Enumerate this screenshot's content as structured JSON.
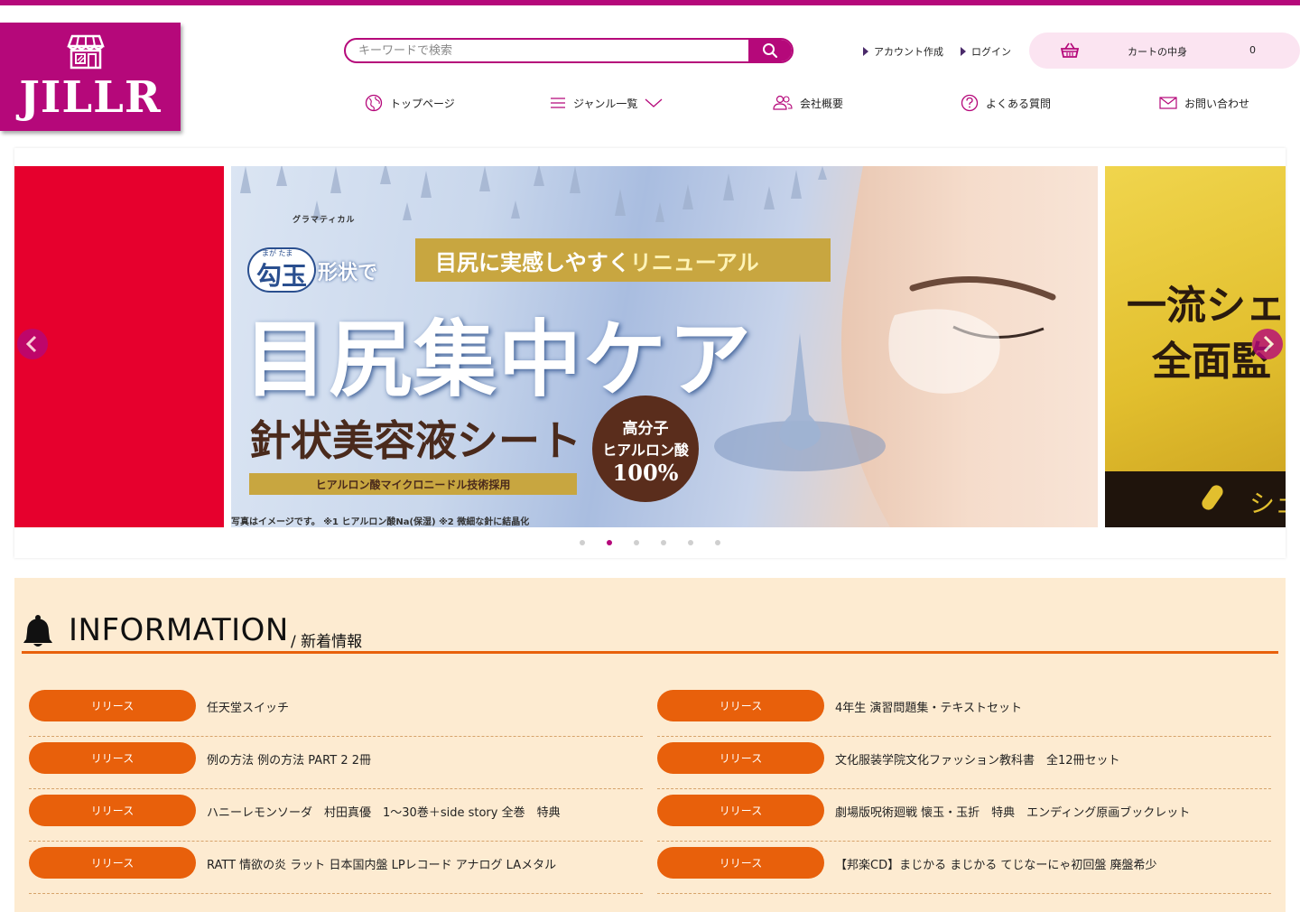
{
  "brand": {
    "logo_text": "JILLR",
    "accent": "#b5087a",
    "orange": "#e8600b"
  },
  "search": {
    "placeholder": "キーワードで検索"
  },
  "header_links": {
    "create_account": "アカウント作成",
    "login": "ログイン"
  },
  "cart": {
    "label": "カートの中身",
    "count": "0"
  },
  "nav": [
    {
      "label": "トップページ",
      "icon": "globe-icon"
    },
    {
      "label": "ジャンル一覧",
      "icon": "menu-icon"
    },
    {
      "label": "会社概要",
      "icon": "users-icon"
    },
    {
      "label": "よくある質問",
      "icon": "question-icon"
    },
    {
      "label": "お問い合わせ",
      "icon": "mail-icon"
    }
  ],
  "banner": {
    "brand_small": "グラマティカル",
    "tagline": "目尻に実感しやすく",
    "tagline_accent": "リニューアル",
    "magatama": "勾玉",
    "magatama_ruby": "まが たま",
    "shape_text": "形状で",
    "headline": "目尻集中ケア",
    "product": "針状美容液シート",
    "tech": "ヒアルロン酸マイクロニードル技術採用",
    "circle_line1": "高分子",
    "circle_line2": "ヒアルロン酸",
    "circle_line3": "100%",
    "footnote": "写真はイメージです。 ※1 ヒアルロン酸Na(保湿) ※2 微細な針に結晶化",
    "right_line1": "一流シェ",
    "right_line2": "全面監",
    "right_line3": "シェ"
  },
  "slider": {
    "dot_count": 6,
    "active_index": 1
  },
  "information": {
    "title": "INFORMATION",
    "subtitle": "/ 新着情報",
    "items": [
      {
        "tag": "リリース",
        "text": "任天堂スイッチ"
      },
      {
        "tag": "リリース",
        "text": "4年生 演習問題集・テキストセット"
      },
      {
        "tag": "リリース",
        "text": "例の方法 例の方法 PART 2 2冊"
      },
      {
        "tag": "リリース",
        "text": "文化服装学院文化ファッション教科書　全12冊セット"
      },
      {
        "tag": "リリース",
        "text": "ハニーレモンソーダ　村田真優　1〜30巻＋side story 全巻　特典"
      },
      {
        "tag": "リリース",
        "text": "劇場版呪術廻戦 懐玉・玉折　特典　エンディング原画ブックレット"
      },
      {
        "tag": "リリース",
        "text": "RATT 情欲の炎 ラット 日本国内盤 LPレコード アナログ LAメタル"
      },
      {
        "tag": "リリース",
        "text": "【邦楽CD】まじかる まじかる てじなーにゃ初回盤 廃盤希少"
      }
    ]
  }
}
